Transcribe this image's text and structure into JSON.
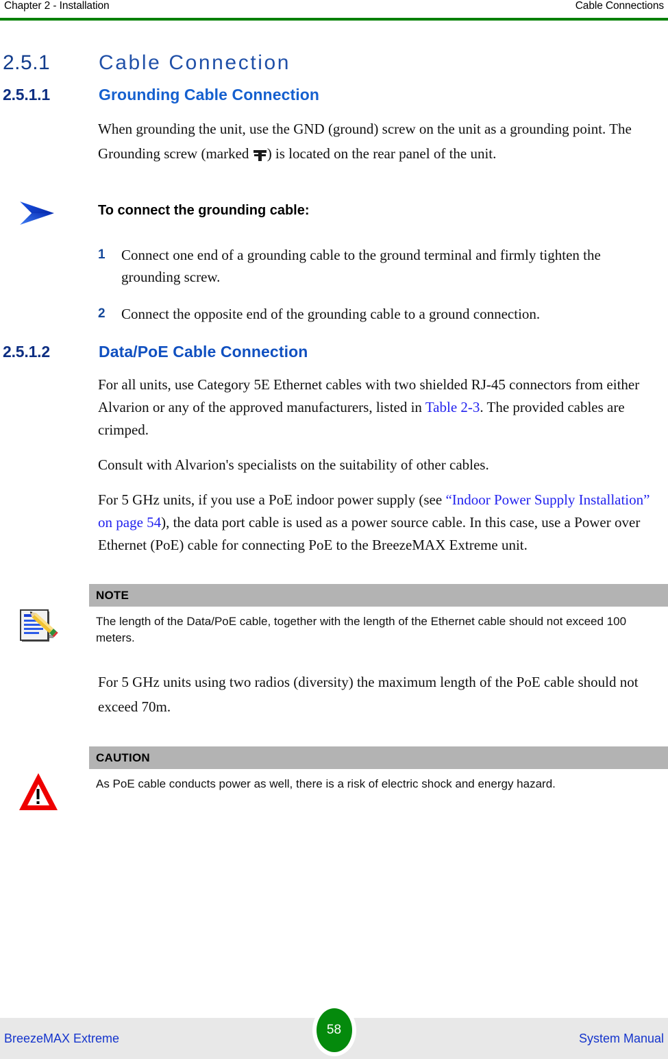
{
  "header": {
    "left": "Chapter 2 - Installation",
    "right": "Cable Connections",
    "rule_color": "#008000"
  },
  "sections": {
    "h2": {
      "number": "2.5.1",
      "title": "Cable Connection"
    },
    "h3_grounding": {
      "number": "2.5.1.1",
      "title": "Grounding Cable Connection"
    },
    "h3_datapoe": {
      "number": "2.5.1.2",
      "title": "Data/PoE Cable Connection"
    }
  },
  "paragraphs": {
    "grounding_intro_a": "When grounding the unit, use the GND (ground) screw on the unit as a grounding point. The Grounding screw (marked ",
    "grounding_intro_b": ") is located on the rear panel of the unit.",
    "datapoe_p1_a": "For all units, use Category 5E Ethernet cables with two shielded RJ-45 connectors from either Alvarion or any of the approved manufacturers, listed in ",
    "datapoe_p1_link": "Table 2-3",
    "datapoe_p1_b": ". The provided cables are crimped.",
    "datapoe_p2": "Consult with Alvarion's specialists on the suitability of other cables.",
    "datapoe_p3_a": "For 5 GHz units, if you use a PoE indoor power supply (see ",
    "datapoe_p3_link": "“Indoor Power Supply Installation” on page 54",
    "datapoe_p3_b": "), the data port cable is used as a power source cable. In this case, use a Power over Ethernet (PoE) cable for connecting PoE to the BreezeMAX Extreme unit.",
    "datapoe_p4": "For 5 GHz units using two radios (diversity) the maximum length of the PoE cable should not exceed 70m."
  },
  "procedure": {
    "icon": "blue-arrow-icon",
    "title": "To connect the grounding cable:",
    "steps": [
      {
        "number": "1",
        "text": "Connect one end of a grounding cable to the ground terminal and firmly tighten the grounding screw."
      },
      {
        "number": "2",
        "text": "Connect the opposite end of the grounding cable to a ground connection."
      }
    ]
  },
  "admonitions": {
    "note": {
      "icon": "note-pencil-icon",
      "label": "NOTE",
      "text": "The length of the Data/PoE cable, together with the length of the Ethernet cable should not exceed 100 meters."
    },
    "caution": {
      "icon": "warning-triangle-icon",
      "label": "CAUTION",
      "text": "As PoE cable conducts power as well, there is a risk of electric shock and energy hazard."
    }
  },
  "footer": {
    "left": "BreezeMAX Extreme",
    "page_number": "58",
    "right": "System Manual",
    "badge_color": "#048a0c",
    "band_color": "#e8e8e8"
  }
}
